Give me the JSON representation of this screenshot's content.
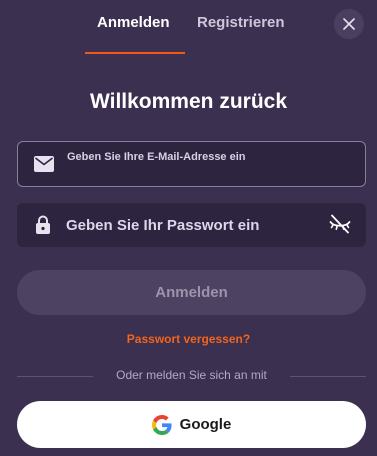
{
  "tabs": {
    "login_label": "Anmelden",
    "register_label": "Registrieren",
    "active": "login"
  },
  "title": "Willkommen zurück",
  "email_field": {
    "placeholder": "Geben Sie Ihre E-Mail-Adresse ein",
    "value": "",
    "icon": "envelope-icon"
  },
  "password_field": {
    "placeholder": "Geben Sie Ihr Passwort ein",
    "value": "",
    "icon": "lock-icon",
    "toggle_icon": "eye-off-icon"
  },
  "login_button_label": "Anmelden",
  "forgot_password_label": "Passwort vergessen?",
  "divider_label": "Oder melden Sie sich an mit",
  "google_button_label": "Google",
  "colors": {
    "background": "#3b3050",
    "accent": "#f05a14",
    "field_background": "#2d2440",
    "disabled_button": "#4d4261"
  }
}
